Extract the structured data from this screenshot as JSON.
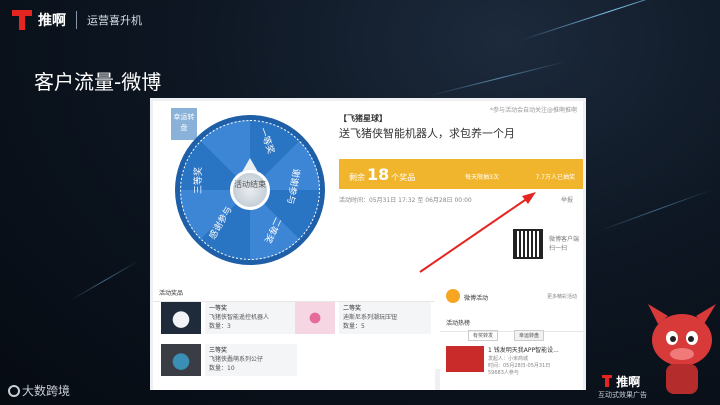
{
  "header": {
    "brand_name": "推啊",
    "brand_sub": "运营喜升机",
    "slide_title": "客户流量-微博"
  },
  "activity": {
    "tag": "幸运转盘",
    "share_note": "*参与活动会自动关注@推啊推啊",
    "title": "【飞猪星球】",
    "description": "送飞猪侠智能机器人，求包养一个月",
    "remaining_prefix": "剩余",
    "remaining_count": "18",
    "remaining_suffix": "个奖品",
    "draw_rule": "每天限抽3次",
    "participants": "7.7万人已抽奖",
    "time": "活动时间：05月31日 17:32 至 06月28日 00:00",
    "report": "举报",
    "qr_text": "微博客户端扫一扫",
    "wheel": {
      "hub": "活动结束",
      "segments": [
        "一等奖",
        "谢谢参与",
        "二等奖",
        "感谢参与",
        "三等奖"
      ]
    }
  },
  "prizes": {
    "head": "活动奖品",
    "items": [
      {
        "name": "一等奖",
        "desc": "飞猪侠智能遥控机器人",
        "qty": "数量：3"
      },
      {
        "name": "二等奖",
        "desc": "迪斯尼系列潮玩压钮",
        "qty": "数量：5"
      },
      {
        "name": "三等奖",
        "desc": "飞猪侠蠢萌系列公仔",
        "qty": "数量：10"
      }
    ]
  },
  "sidebar": {
    "weibo_label": "微博活动",
    "weibo_more": "更多精彩活动",
    "hot_head": "活动热榜",
    "tab_a": "有奖转发",
    "tab_b": "幸运转盘",
    "hot_item_title": "1 钱发明天我APP智能设...",
    "hot_item_line1": "发起人：小米商城",
    "hot_item_line2": "时间：05月28日-05月31日",
    "hot_item_line3": "59683人参与"
  },
  "footer": {
    "dsk": "大数跨境",
    "brand": "推啊",
    "brand_sub": "互动式效果广告"
  },
  "colors": {
    "brand_red": "#e52521",
    "band_yellow": "#f0b52d",
    "wheel_blue": "#2a74c4"
  }
}
